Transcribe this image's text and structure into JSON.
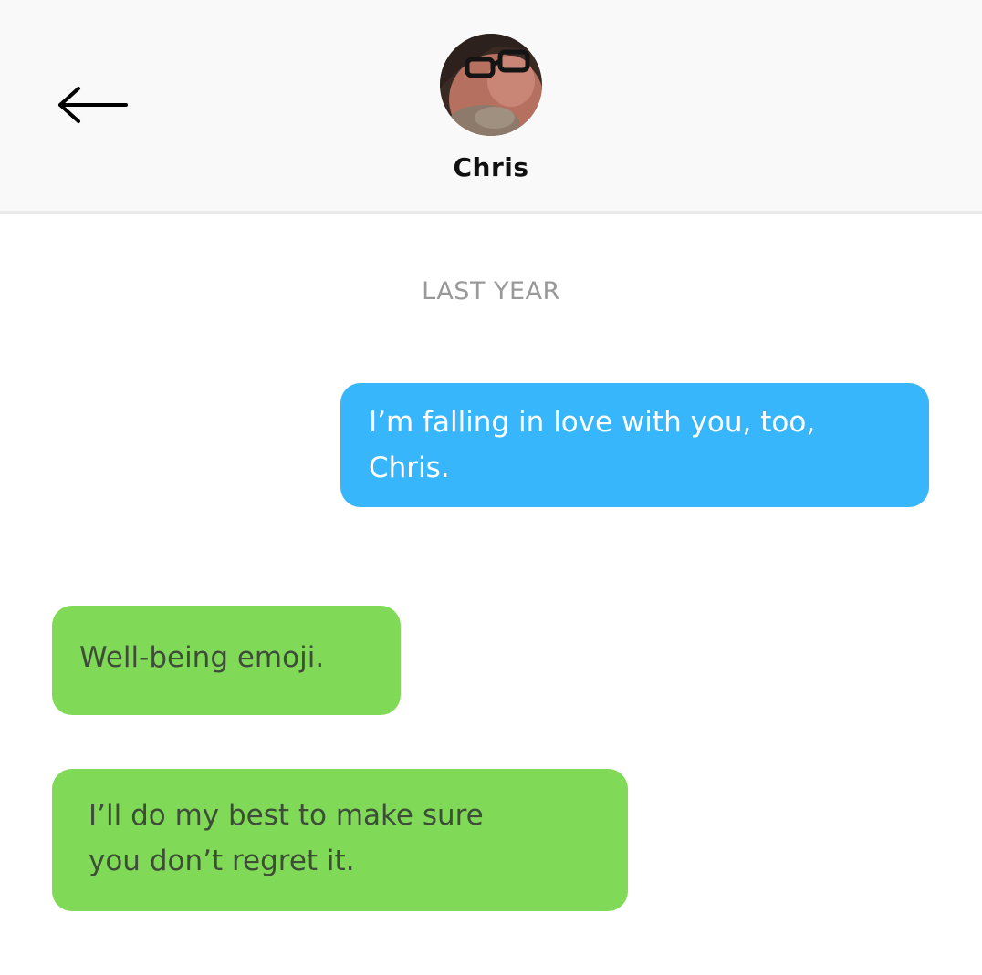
{
  "header": {
    "back_icon": "arrow-left-icon",
    "contact_name": "Chris"
  },
  "conversation": {
    "timestamp": "LAST YEAR",
    "messages": [
      {
        "direction": "outgoing",
        "text": "I’m falling in love with you, too,\nChris.",
        "color": "#38b6fc"
      },
      {
        "direction": "incoming",
        "text": "Well-being emoji.",
        "color": "#80da58"
      },
      {
        "direction": "incoming",
        "text": "I’ll do my best to make sure\nyou don’t regret it.",
        "color": "#80da58"
      }
    ]
  }
}
